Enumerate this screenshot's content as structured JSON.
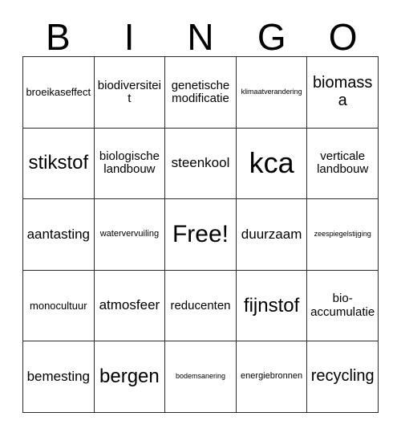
{
  "card": {
    "title_letters": [
      "B",
      "I",
      "N",
      "G",
      "O"
    ],
    "free_space_label": "Free!",
    "colors": {
      "background": "#ffffff",
      "border": "#2b2b2b",
      "text": "#000000"
    },
    "grid": {
      "rows": 5,
      "columns": 5,
      "cells": [
        [
          {
            "label": "broeikaseffect",
            "size": "s"
          },
          {
            "label": "biodiversiteit",
            "size": "m"
          },
          {
            "label": "genetische modificatie",
            "size": "m"
          },
          {
            "label": "klimaatverandering",
            "size": "xxs"
          },
          {
            "label": "biomassa",
            "size": "xl"
          }
        ],
        [
          {
            "label": "stikstof",
            "size": "2xl"
          },
          {
            "label": "biologische landbouw",
            "size": "m"
          },
          {
            "label": "steenkool",
            "size": "l"
          },
          {
            "label": "kca",
            "size": "4xl"
          },
          {
            "label": "verticale landbouw",
            "size": "m"
          }
        ],
        [
          {
            "label": "aantasting",
            "size": "l"
          },
          {
            "label": "watervervuiling",
            "size": "xs"
          },
          {
            "label": "Free!",
            "size": "3xl"
          },
          {
            "label": "duurzaam",
            "size": "l"
          },
          {
            "label": "zeespiegelstijging",
            "size": "xxs"
          }
        ],
        [
          {
            "label": "monocultuur",
            "size": "s"
          },
          {
            "label": "atmosfeer",
            "size": "l"
          },
          {
            "label": "reducenten",
            "size": "m"
          },
          {
            "label": "fijnstof",
            "size": "2xl"
          },
          {
            "label": "bio-accumulatie",
            "size": "m"
          }
        ],
        [
          {
            "label": "bemesting",
            "size": "l"
          },
          {
            "label": "bergen",
            "size": "2xl"
          },
          {
            "label": "bodemsanering",
            "size": "xxs"
          },
          {
            "label": "energiebronnen",
            "size": "xs"
          },
          {
            "label": "recycling",
            "size": "xl"
          }
        ]
      ]
    }
  }
}
